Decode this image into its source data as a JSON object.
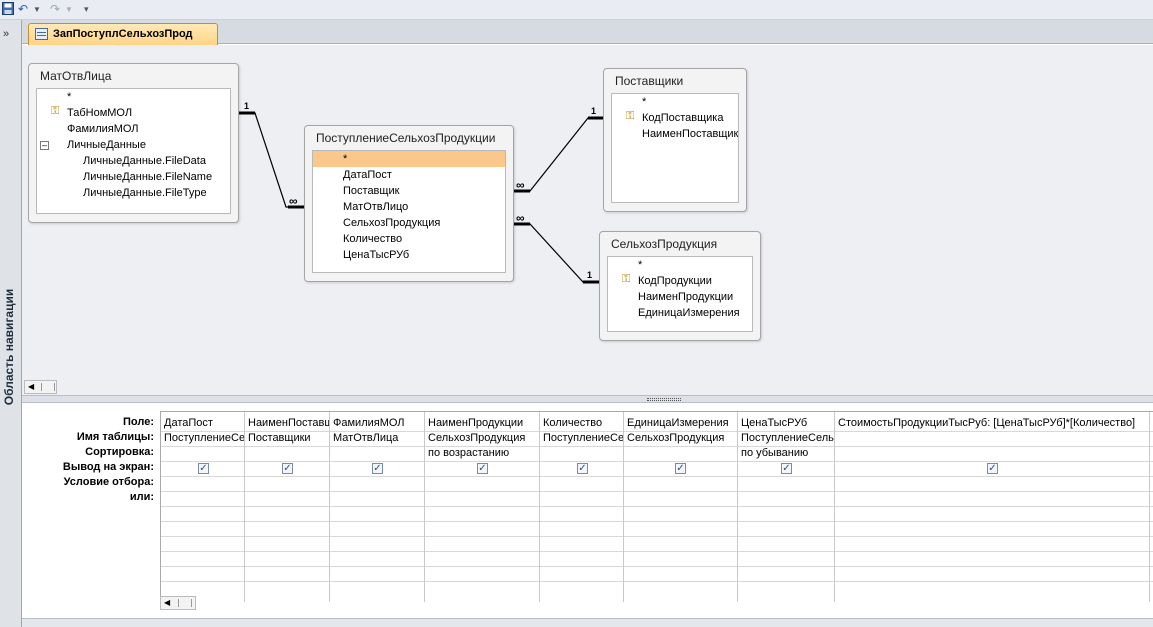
{
  "quick_access": {
    "save_icon": "save-icon",
    "undo_icon": "undo-icon",
    "redo_icon": "redo-icon",
    "customize_icon": "customize-qat-icon"
  },
  "nav_pane": {
    "expand_icon": "»",
    "title": "Область навигации"
  },
  "tab": {
    "label": "ЗапПоступлСельхозПрод"
  },
  "tables": {
    "matotvlica": {
      "title": "МатОтвЛица",
      "fields": [
        "*",
        "ТабНомМОЛ",
        "ФамилияМОЛ",
        "ЛичныеДанные",
        "ЛичныеДанные.FileData",
        "ЛичныеДанные.FileName",
        "ЛичныеДанные.FileType"
      ]
    },
    "postuplenie": {
      "title": "ПоступлениеСельхозПродукции",
      "fields": [
        "*",
        "ДатаПост",
        "Поставщик",
        "МатОтвЛицо",
        "СельхозПродукция",
        "Количество",
        "ЦенаТысРУб"
      ]
    },
    "postavshiki": {
      "title": "Поставщики",
      "fields": [
        "*",
        "КодПоставщика",
        "НаименПоставщика"
      ]
    },
    "selhozprod": {
      "title": "СельхозПродукция",
      "fields": [
        "*",
        "КодПродукции",
        "НаименПродукции",
        "ЕдиницаИзмерения"
      ]
    }
  },
  "relationships": {
    "one": "1",
    "many": "∞"
  },
  "grid": {
    "row_labels": [
      "Поле:",
      "Имя таблицы:",
      "Сортировка:",
      "Вывод на экран:",
      "Условие отбора:",
      "или:"
    ],
    "columns": [
      {
        "field": "ДатаПост",
        "table": "ПоступлениеСельхозПродукции",
        "sort": "",
        "show": true
      },
      {
        "field": "НаименПоставщика",
        "table": "Поставщики",
        "sort": "",
        "show": true
      },
      {
        "field": "ФамилияМОЛ",
        "table": "МатОтвЛица",
        "sort": "",
        "show": true
      },
      {
        "field": "НаименПродукции",
        "table": "СельхозПродукция",
        "sort": "по возрастанию",
        "show": true
      },
      {
        "field": "Количество",
        "table": "ПоступлениеСельхозПродукции",
        "sort": "",
        "show": true
      },
      {
        "field": "ЕдиницаИзмерения",
        "table": "СельхозПродукция",
        "sort": "",
        "show": true
      },
      {
        "field": "ЦенаТысРУб",
        "table": "ПоступлениеСельхозПродукции",
        "sort": "по убыванию",
        "show": true
      },
      {
        "field": "СтоимостьПродукцииТысРуб: [ЦенаТысРУб]*[Количество]",
        "table": "",
        "sort": "",
        "show": true
      }
    ]
  }
}
